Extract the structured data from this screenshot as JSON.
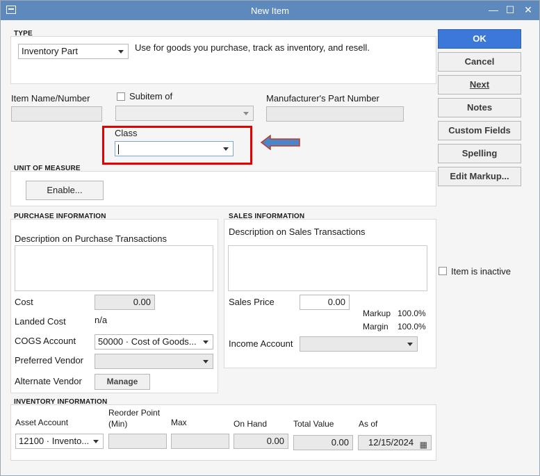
{
  "window": {
    "title": "New Item",
    "minimize_glyph": "—",
    "maximize_glyph": "☐",
    "close_glyph": "✕"
  },
  "type_section": {
    "heading": "TYPE",
    "selected_type": "Inventory Part",
    "description": "Use for goods you purchase, track as inventory, and resell."
  },
  "identity": {
    "item_name_label": "Item Name/Number",
    "item_name_value": "",
    "subitem_label": "Subitem of",
    "subitem_value": "",
    "manufacturer_label": "Manufacturer's Part Number",
    "manufacturer_value": "",
    "class_label": "Class",
    "class_value": ""
  },
  "unit_of_measure": {
    "heading": "UNIT OF MEASURE",
    "enable_label": "Enable..."
  },
  "purchase": {
    "heading": "PURCHASE INFORMATION",
    "description_label": "Description on Purchase Transactions",
    "description_value": "",
    "cost_label": "Cost",
    "cost_value": "0.00",
    "landed_cost_label": "Landed Cost",
    "landed_cost_value": "n/a",
    "cogs_label": "COGS Account",
    "cogs_value": "50000 · Cost of Goods...",
    "preferred_vendor_label": "Preferred Vendor",
    "preferred_vendor_value": "",
    "alternate_vendor_label": "Alternate Vendor",
    "manage_label": "Manage"
  },
  "sales": {
    "heading": "SALES INFORMATION",
    "description_label": "Description on Sales Transactions",
    "description_value": "",
    "price_label": "Sales Price",
    "price_value": "0.00",
    "markup_label": "Markup",
    "markup_value": "100.0%",
    "margin_label": "Margin",
    "margin_value": "100.0%",
    "income_label": "Income Account",
    "income_value": ""
  },
  "inventory": {
    "heading": "INVENTORY INFORMATION",
    "asset_label": "Asset Account",
    "asset_value": "12100 · Invento...",
    "reorder_label_1": "Reorder Point",
    "reorder_label_2": "(Min)",
    "reorder_value": "",
    "max_label": "Max",
    "max_value": "",
    "onhand_label": "On Hand",
    "onhand_value": "0.00",
    "total_label": "Total Value",
    "total_value": "0.00",
    "asof_label": "As of",
    "asof_value": "12/15/2024"
  },
  "buttons": {
    "ok": "OK",
    "cancel": "Cancel",
    "next": "Next",
    "notes": "Notes",
    "custom_fields": "Custom Fields",
    "spelling": "Spelling",
    "edit_markup": "Edit Markup..."
  },
  "inactive_label": "Item is inactive",
  "colors": {
    "highlight_box": "#e60000",
    "arrow": "#4a86c8",
    "ok_button": "#3c78d8",
    "titlebar": "#5e89bd"
  },
  "icons": {
    "calendar": "calendar-icon",
    "arrow": "left-arrow-icon"
  }
}
